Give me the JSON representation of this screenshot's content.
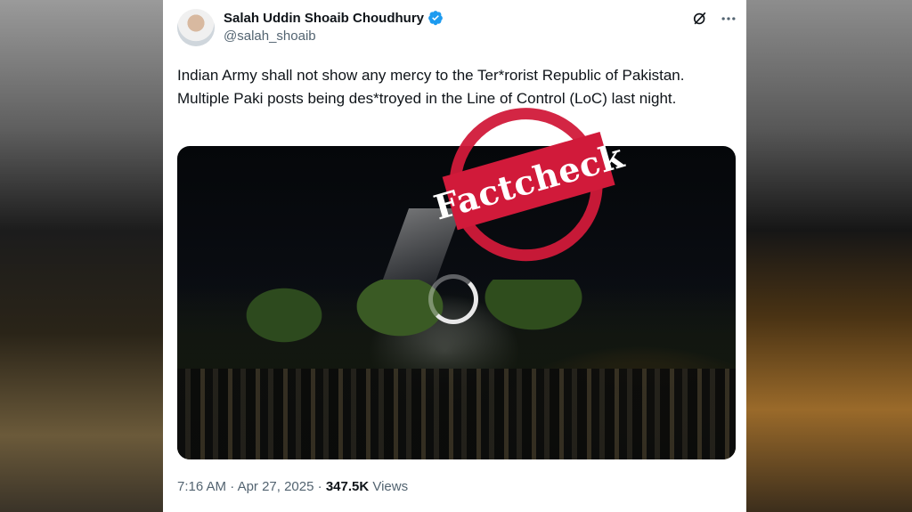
{
  "author": {
    "name": "Salah Uddin Shoaib Choudhury",
    "handle": "@salah_shoaib",
    "verified": true
  },
  "tweet": {
    "text": "Indian Army shall not show any mercy to the Ter*rorist Republic of Pakistan. Multiple Paki posts being des*troyed in the Line of Control (LoC) last night."
  },
  "stamp": {
    "label": "Factcheck"
  },
  "meta": {
    "time": "7:16 AM",
    "date": "Apr 27, 2025",
    "views_count": "347.5K",
    "views_label": "Views",
    "separator": "·"
  },
  "colors": {
    "verified_blue": "#1d9bf0",
    "stamp_red": "#d11a3a",
    "text_primary": "#0f1419",
    "text_secondary": "#536471"
  },
  "icons": [
    "verified-badge-icon",
    "grok-icon",
    "more-icon",
    "loading-spinner-icon"
  ]
}
